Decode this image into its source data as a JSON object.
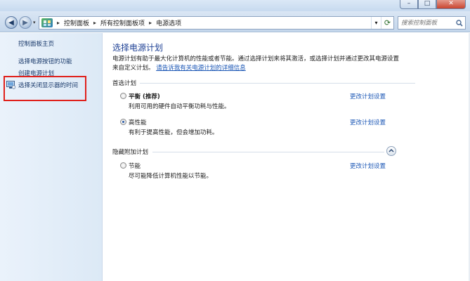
{
  "window": {
    "minimize_symbol": "–",
    "maximize_symbol": "□",
    "close_symbol": "✕"
  },
  "nav": {
    "back_symbol": "◀",
    "forward_symbol": "▶",
    "dropdown_symbol": "▾",
    "breadcrumbs": [
      "控制面板",
      "所有控制面板项",
      "电源选项"
    ],
    "separator": "▸",
    "refresh_symbol": "⟳",
    "search_placeholder": "搜索控制面板"
  },
  "sidebar": {
    "home": "控制面板主页",
    "items": [
      "选择电源按钮的功能",
      "创建电源计划",
      "选择关闭显示器的时间"
    ]
  },
  "main": {
    "title": "选择电源计划",
    "description": "电源计划有助于最大化计算机的性能或者节能。通过选择计划来将其激活，或选择计划并通过更改其电源设置来自定义计划。",
    "description_link": "请告诉我有关电源计划的详细信息",
    "preferred_heading": "首选计划",
    "hidden_heading": "隐藏附加计划",
    "change_label": "更改计划设置",
    "plans": [
      {
        "name": "平衡 (推荐)",
        "desc": "利用可用的硬件自动平衡功耗与性能。",
        "checked": false
      },
      {
        "name": "高性能",
        "desc": "有利于提高性能，但会增加功耗。",
        "checked": true
      },
      {
        "name": "节能",
        "desc": "尽可能降低计算机性能以节能。",
        "checked": false
      }
    ]
  },
  "colors": {
    "link": "#1a56b5",
    "title": "#1c3f94",
    "highlight": "#e0201b"
  }
}
